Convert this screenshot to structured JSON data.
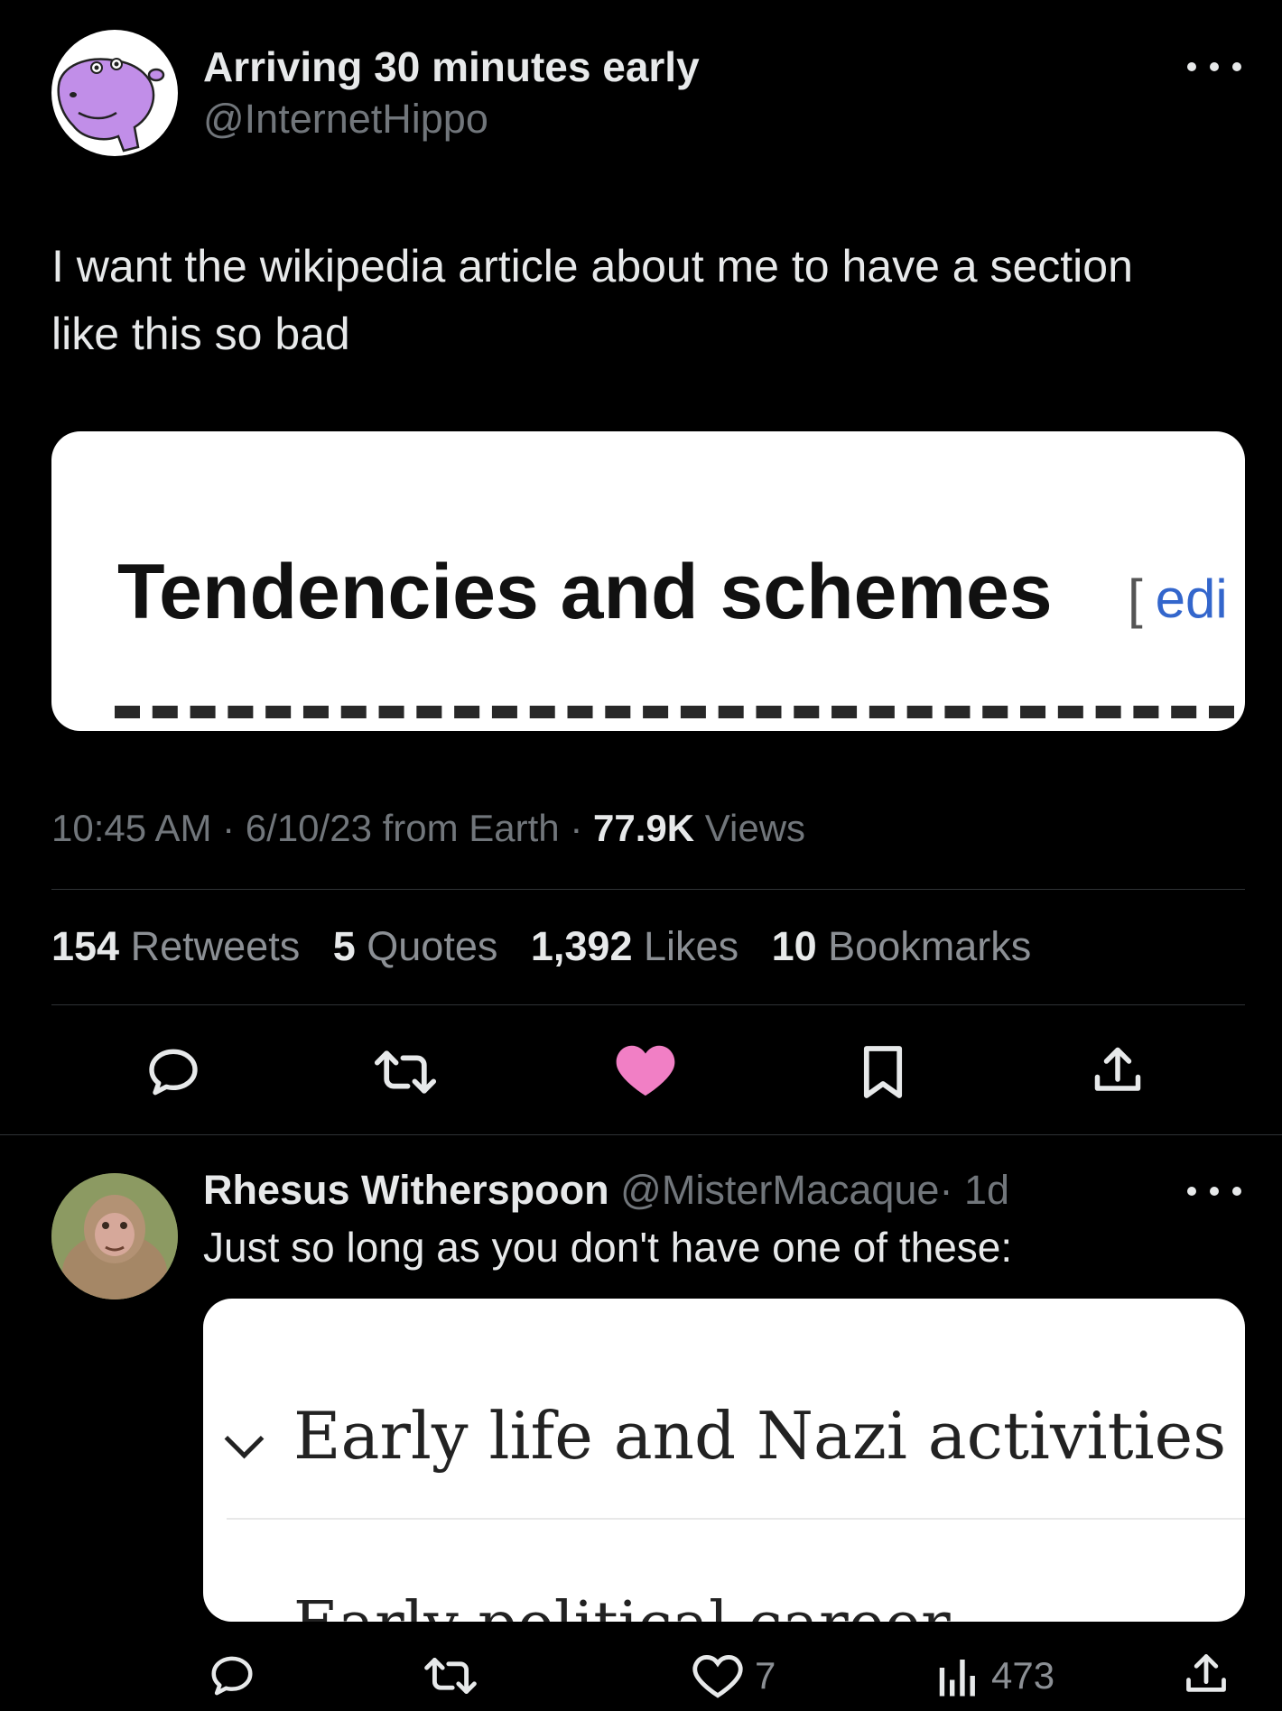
{
  "tweet": {
    "display_name": "Arriving 30 minutes early",
    "handle": "@InternetHippo",
    "text_line1": "I want the wikipedia article about me to have a section",
    "text_line2": "like this so bad",
    "media": {
      "heading": "Tendencies and schemes",
      "edit_bracket": "[",
      "edit_link": "edi"
    },
    "meta": {
      "time": "10:45 AM",
      "date": "6/10/23",
      "source": "from Earth",
      "views_count": "77.9K",
      "views_label": "Views"
    },
    "stats": {
      "retweets_count": "154",
      "retweets_label": "Retweets",
      "quotes_count": "5",
      "quotes_label": "Quotes",
      "likes_count": "1,392",
      "likes_label": "Likes",
      "bookmarks_count": "10",
      "bookmarks_label": "Bookmarks"
    },
    "like_color": "#f17fc5",
    "avatar_color": "#c18ee8"
  },
  "reply": {
    "display_name": "Rhesus Witherspoon",
    "handle": "@MisterMacaque",
    "age": "· 1d",
    "text": "Just so long as you don't have one of these:",
    "media": {
      "section_title": "Early life and Nazi activities",
      "next_section": "Early political career"
    },
    "likes": "7",
    "views": "473"
  },
  "icons": {
    "more": "more-horizontal-icon",
    "reply": "reply-bubble-icon",
    "retweet": "retweet-icon",
    "like": "heart-icon",
    "bookmark": "bookmark-icon",
    "share": "share-icon",
    "views": "analytics-bars-icon"
  }
}
